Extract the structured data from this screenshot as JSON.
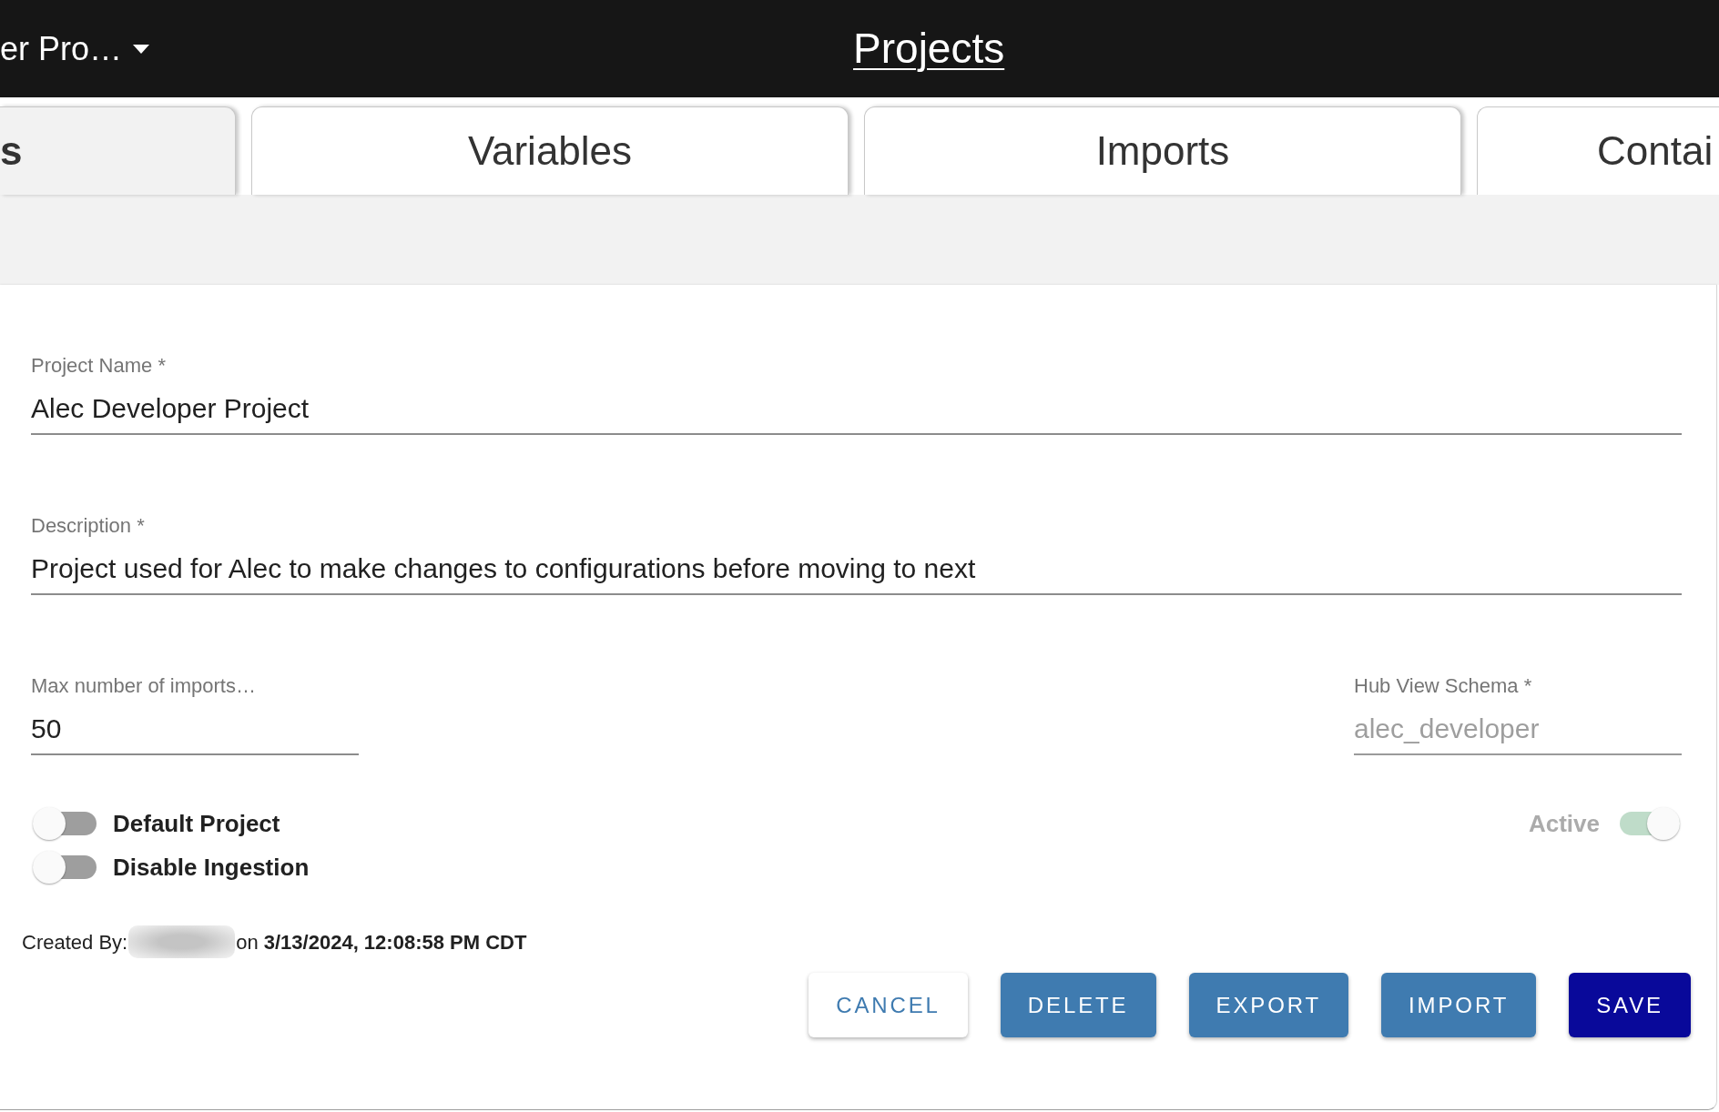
{
  "header": {
    "project_menu": "er Pro…",
    "title": "Projects"
  },
  "tabs": [
    {
      "label": "s",
      "selected": true
    },
    {
      "label": "Variables",
      "selected": false
    },
    {
      "label": "Imports",
      "selected": false
    },
    {
      "label": "Contai",
      "selected": false
    }
  ],
  "fields": [
    {
      "label": "Project Name *",
      "value": "Alec Developer Project",
      "disabled": false
    },
    {
      "label": "Description *",
      "value": "Project used for Alec to make changes to configurations before moving to next",
      "disabled": false
    },
    {
      "label": "Max number of imports…",
      "value": "50",
      "disabled": false
    },
    {
      "label": "Hub View Schema *",
      "value": "alec_developer",
      "disabled": true
    }
  ],
  "switches": [
    {
      "label": "Default Project",
      "on": false,
      "disabled": false
    },
    {
      "label": "Disable Ingestion",
      "on": false,
      "disabled": false
    }
  ],
  "active_switch": {
    "label": "Active",
    "on": true,
    "disabled": true
  },
  "created": {
    "label": "Created By:",
    "detail": "on **3/13/2024, 12:08:58 PM CDT**"
  },
  "buttons": [
    {
      "label": "CANCEL",
      "kind": "outline"
    },
    {
      "label": "DELETE",
      "kind": "secondary"
    },
    {
      "label": "EXPORT",
      "kind": "secondary"
    },
    {
      "label": "IMPORT",
      "kind": "secondary"
    },
    {
      "label": "SAVE",
      "kind": "primary"
    }
  ]
}
